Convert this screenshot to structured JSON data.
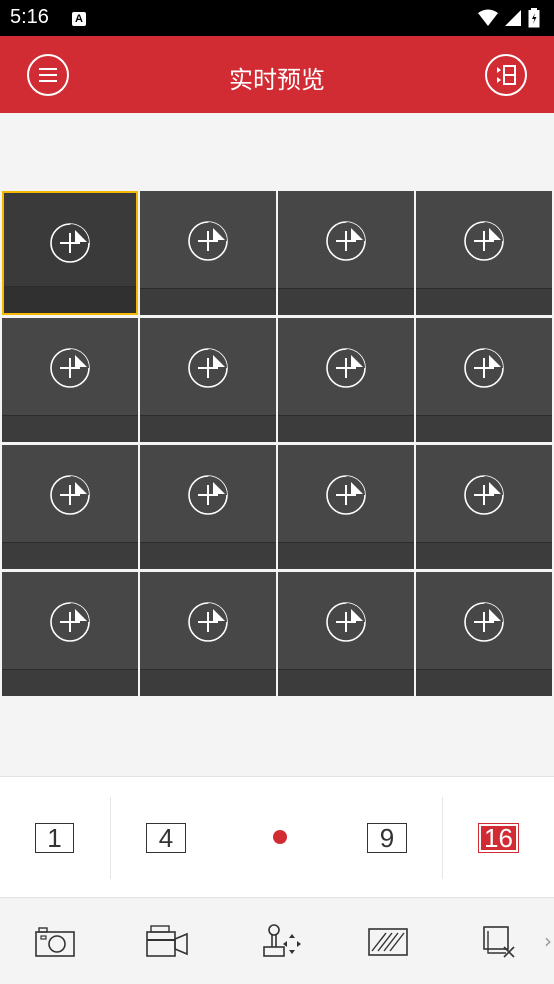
{
  "status_bar": {
    "time": "5:16",
    "notification_icon": "A"
  },
  "app_bar": {
    "title": "实时预览",
    "left_icon": "menu-icon",
    "right_icon": "channel-list-icon"
  },
  "grid": {
    "columns": 4,
    "rows": 4,
    "selected_index": 0,
    "cell_icon": "add-camera-icon"
  },
  "layout_options": {
    "one": "1",
    "four": "4",
    "nine": "9",
    "sixteen": "16",
    "selected": "16"
  },
  "toolbar": {
    "items": [
      "camera-icon",
      "record-video-icon",
      "ptz-joystick-icon",
      "quality-icon",
      "close-window-icon"
    ],
    "more": "›"
  },
  "colors": {
    "brand": "#d12c34",
    "selected_border": "#f5b800",
    "cell": "#474747"
  }
}
